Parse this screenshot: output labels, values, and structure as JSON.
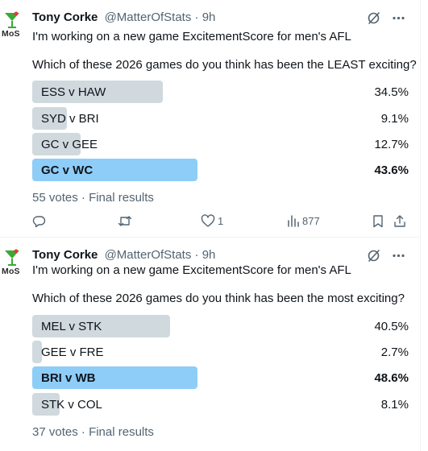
{
  "tweets": [
    {
      "author_name": "Tony Corke",
      "handle": "@MatterOfStats",
      "separator": "·",
      "time": "9h",
      "avatar_text": "MoS",
      "line1": "I'm working on a new game ExcitementScore for men's AFL",
      "line2": "Which of these 2026 games do you think has been the LEAST exciting?",
      "poll": [
        {
          "label": "ESS v HAW",
          "percent": "34.5%",
          "value": 34.5,
          "winner": false
        },
        {
          "label": "SYD v BRI",
          "percent": "9.1%",
          "value": 9.1,
          "winner": false
        },
        {
          "label": "GC v GEE",
          "percent": "12.7%",
          "value": 12.7,
          "winner": false
        },
        {
          "label": "GC v WC",
          "percent": "43.6%",
          "value": 43.6,
          "winner": true
        }
      ],
      "votes": "55 votes",
      "status": "Final results",
      "likes": "1",
      "views": "877"
    },
    {
      "author_name": "Tony Corke",
      "handle": "@MatterOfStats",
      "separator": "·",
      "time": "9h",
      "avatar_text": "MoS",
      "line1": "I'm working on a new game ExcitementScore for men's AFL",
      "line2": "Which of these 2026 games do you think has been the most exciting?",
      "poll": [
        {
          "label": "MEL v STK",
          "percent": "40.5%",
          "value": 40.5,
          "winner": false
        },
        {
          "label": "GEE v FRE",
          "percent": "2.7%",
          "value": 2.7,
          "winner": false
        },
        {
          "label": "BRI v WB",
          "percent": "48.6%",
          "value": 48.6,
          "winner": true
        },
        {
          "label": "STK v COL",
          "percent": "8.1%",
          "value": 8.1,
          "winner": false
        }
      ],
      "votes": "37 votes",
      "status": "Final results"
    }
  ],
  "colors": {
    "bar": "#cfd9de",
    "winner_bar": "#8ecdf8",
    "muted_text": "#536471",
    "logo_green": "#3aa935"
  },
  "icons": [
    "grok-icon",
    "more-icon",
    "reply-icon",
    "retweet-icon",
    "like-icon",
    "views-icon",
    "bookmark-icon",
    "share-icon"
  ]
}
